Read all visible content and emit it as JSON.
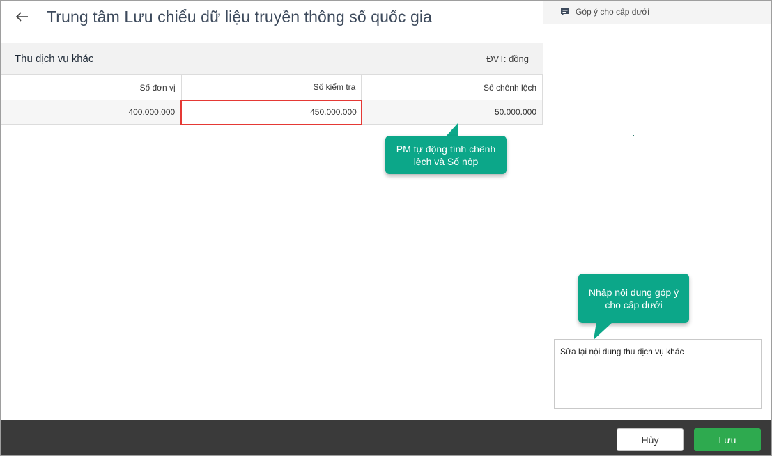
{
  "header": {
    "title": "Trung tâm Lưu chiểu dữ liệu truyền thông số quốc gia"
  },
  "section": {
    "title": "Thu dịch vụ khác",
    "unit": "ĐVT: đồng"
  },
  "table": {
    "columns": [
      "Số đơn vị",
      "Số kiểm tra",
      "Số chênh lệch"
    ],
    "rows": [
      [
        "400.000.000",
        "450.000.000",
        "50.000.000"
      ]
    ]
  },
  "side_panel": {
    "title": "Góp ý cho cấp dưới",
    "comment_value": "Sửa lại nội dung thu dịch vụ khác"
  },
  "callouts": {
    "auto_calc": "PM tự động tính chênh lệch và Số nộp",
    "enter_comment": "Nhập nội dung góp ý cho cấp dưới"
  },
  "footer": {
    "cancel_label": "Hủy",
    "save_label": "Lưu"
  },
  "colors": {
    "callout": "#0ca789",
    "save": "#2eaa4f",
    "highlight_border": "#e53935",
    "footer_bg": "#3a3a3a"
  },
  "icons": {
    "back": "arrow-left-icon",
    "comment": "comment-icon"
  }
}
